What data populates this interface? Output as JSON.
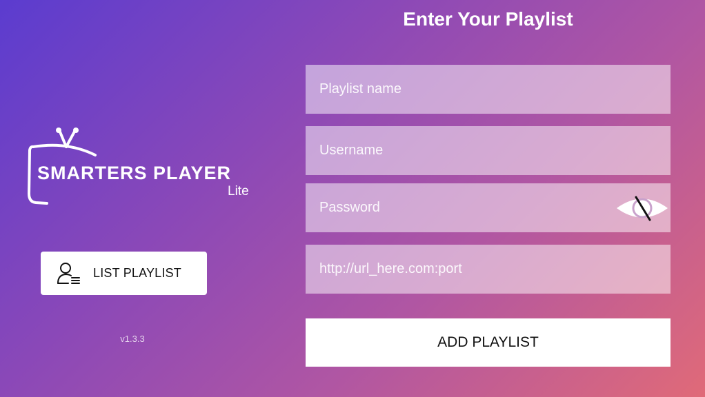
{
  "logo": {
    "brand": "SMARTERS PLAYER",
    "sub": "Lite"
  },
  "list_button": {
    "label": "LIST PLAYLIST",
    "icon": "user-list-icon"
  },
  "version": "v1.3.3",
  "form": {
    "title": "Enter Your Playlist",
    "fields": [
      {
        "placeholder": "Playlist name",
        "value": ""
      },
      {
        "placeholder": "Username",
        "value": ""
      },
      {
        "placeholder": "Password",
        "value": ""
      },
      {
        "placeholder": "http://url_here.com:port",
        "value": ""
      }
    ],
    "password_toggle_icon": "eye-slash-icon",
    "submit_label": "ADD PLAYLIST"
  },
  "colors": {
    "gradient_start": "#5b3ccf",
    "gradient_end": "#e06a78"
  }
}
